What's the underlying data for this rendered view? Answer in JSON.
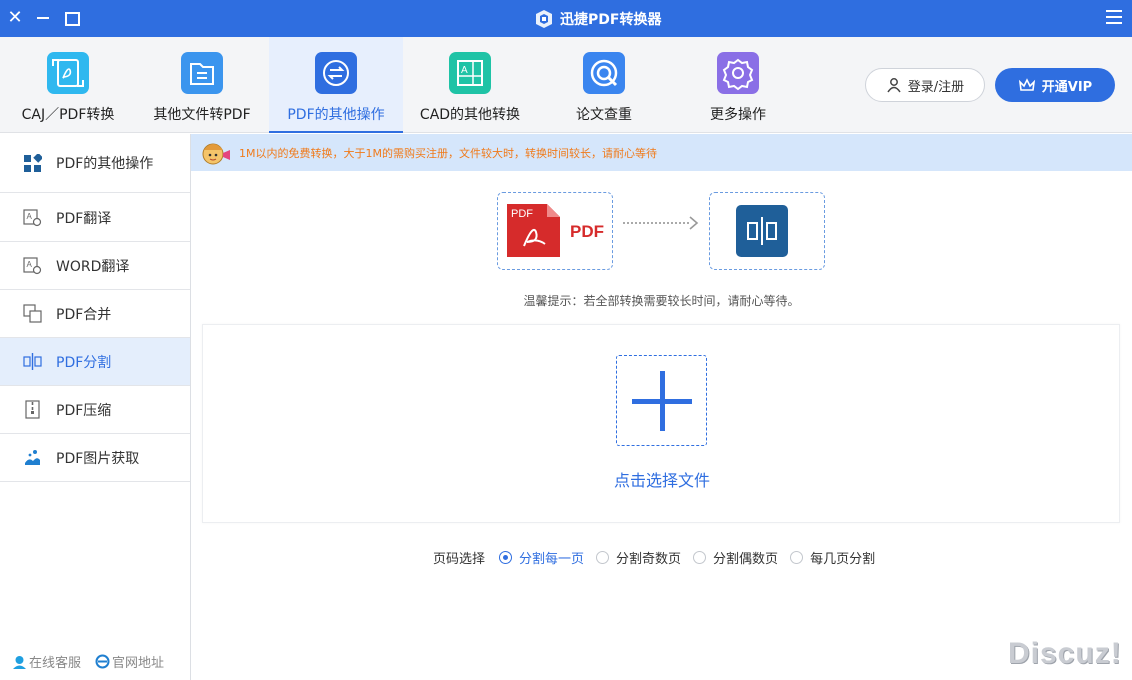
{
  "window": {
    "title": "迅捷PDF转换器",
    "accent": "#2f6ee0"
  },
  "toolbar": {
    "tabs": [
      {
        "label": "CAJ／PDF转换",
        "icon": "caj-pdf-icon",
        "color": "#2fb8ef"
      },
      {
        "label": "其他文件转PDF",
        "icon": "folder-icon",
        "color": "#3b95ee"
      },
      {
        "label": "PDF的其他操作",
        "icon": "exchange-icon",
        "color": "#2f6ee0",
        "active": true
      },
      {
        "label": "CAD的其他转换",
        "icon": "cad-icon",
        "color": "#1fc3a6"
      },
      {
        "label": "论文查重",
        "icon": "search-icon",
        "color": "#3a85ef"
      },
      {
        "label": "更多操作",
        "icon": "gear-icon",
        "color": "#8a6fe6"
      }
    ],
    "login_label": "登录/注册",
    "vip_label": "开通VIP"
  },
  "sidebar": {
    "header": "PDF的其他操作",
    "items": [
      {
        "label": "PDF翻译",
        "icon": "translate-icon"
      },
      {
        "label": "WORD翻译",
        "icon": "translate-icon"
      },
      {
        "label": "PDF合并",
        "icon": "merge-icon"
      },
      {
        "label": "PDF分割",
        "icon": "split-icon",
        "active": true
      },
      {
        "label": "PDF压缩",
        "icon": "compress-icon"
      },
      {
        "label": "PDF图片获取",
        "icon": "image-extract-icon"
      }
    ],
    "footer": {
      "service": "在线客服",
      "website": "官网地址"
    }
  },
  "main": {
    "notice": "1M以内的免费转换，大于1M的需购买注册，文件较大时，转换时间较长，请耐心等待",
    "flow": {
      "from_badge": "PDF",
      "from_label": "PDF"
    },
    "tip": "温馨提示：若全部转换需要较长时间，请耐心等待。",
    "drop_label": "点击选择文件",
    "page_select": {
      "label": "页码选择",
      "options": [
        {
          "label": "分割每一页",
          "selected": true
        },
        {
          "label": "分割奇数页",
          "selected": false
        },
        {
          "label": "分割偶数页",
          "selected": false
        },
        {
          "label": "每几页分割",
          "selected": false
        }
      ]
    }
  },
  "watermark": "Discuz!"
}
